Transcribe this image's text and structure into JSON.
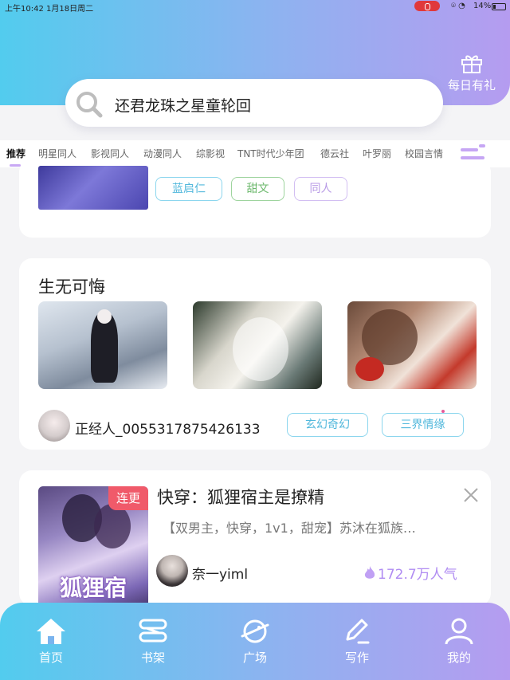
{
  "status_bar": {
    "time": "上午10:42",
    "date": "1月18日周二",
    "battery": "14%"
  },
  "header": {
    "gift_label": "每日有礼"
  },
  "search": {
    "text": "还君龙珠之星童轮回"
  },
  "tabs": [
    "推荐",
    "明星同人",
    "影视同人",
    "动漫同人",
    "综影视",
    "TNT时代少年团",
    "德云社",
    "叶罗丽",
    "校园言情"
  ],
  "card1": {
    "tags": [
      "蓝启仁",
      "甜文",
      "同人"
    ]
  },
  "card2": {
    "title": "生无可悔",
    "author": "正经人_0055317875426133",
    "tags": [
      "玄幻奇幻",
      "三界情缘"
    ]
  },
  "card3": {
    "badge": "连更",
    "cover_text": "狐狸宿",
    "title": "快穿：狐狸宿主是撩精",
    "description": "【双男主，快穿，1v1，甜宠】苏沐在狐族…",
    "author": "奈一yiml",
    "popularity": "172.7万人气"
  },
  "bottom_nav": [
    "首页",
    "书架",
    "广场",
    "写作",
    "我的"
  ],
  "colors": {
    "accent_cyan": "#52ccee",
    "accent_purple": "#b59cf0",
    "badge_red": "#f05a6a"
  }
}
